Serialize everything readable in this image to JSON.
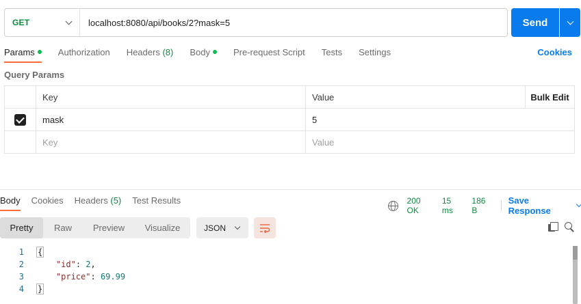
{
  "request": {
    "method": "GET",
    "url": "localhost:8080/api/books/2?mask=5",
    "send_label": "Send"
  },
  "request_tabs": [
    {
      "label": "Params",
      "dot": true,
      "active": true
    },
    {
      "label": "Authorization"
    },
    {
      "label": "Headers",
      "count": "(8)"
    },
    {
      "label": "Body",
      "dot": true
    },
    {
      "label": "Pre-request Script"
    },
    {
      "label": "Tests"
    },
    {
      "label": "Settings"
    }
  ],
  "cookies_label": "Cookies",
  "query_params": {
    "title": "Query Params",
    "headers": {
      "key": "Key",
      "value": "Value",
      "bulk_edit": "Bulk Edit"
    },
    "rows": [
      {
        "checked": true,
        "key": "mask",
        "value": "5"
      }
    ],
    "placeholder": {
      "key": "Key",
      "value": "Value"
    }
  },
  "response_tabs": [
    {
      "label": "Body",
      "active": true
    },
    {
      "label": "Cookies"
    },
    {
      "label": "Headers",
      "count": "(5)"
    },
    {
      "label": "Test Results"
    }
  ],
  "response_meta": {
    "status": "200 OK",
    "time": "15 ms",
    "size": "186 B",
    "save_label": "Save Response"
  },
  "view_modes": [
    "Pretty",
    "Raw",
    "Preview",
    "Visualize"
  ],
  "format": "JSON",
  "body_lines": [
    {
      "num": "1",
      "text": "{"
    },
    {
      "num": "2",
      "key": "\"id\"",
      "value": "2"
    },
    {
      "num": "3",
      "key": "\"price\"",
      "value": "69.99"
    },
    {
      "num": "4",
      "text": "}"
    }
  ],
  "colors": {
    "accent": "#097bed",
    "active_tab": "#ff6c37",
    "success": "#0b8a3e"
  }
}
